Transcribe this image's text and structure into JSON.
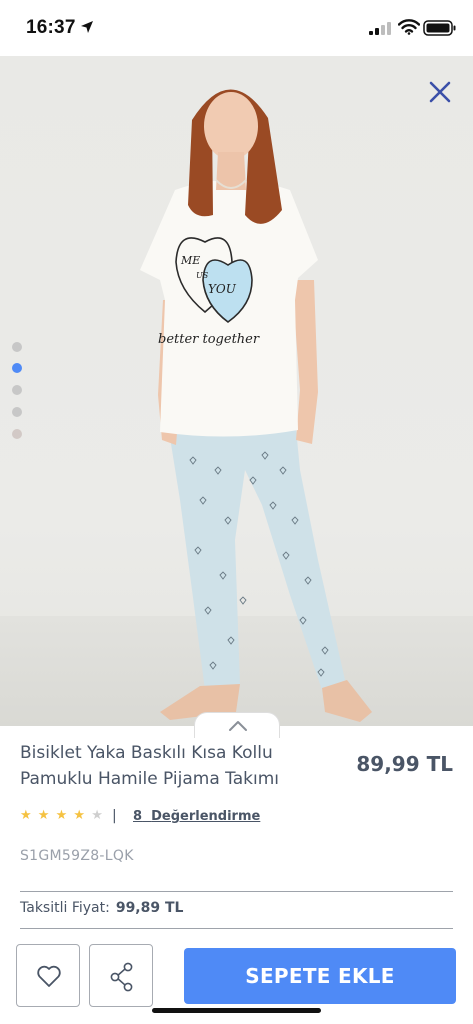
{
  "status_bar": {
    "time": "16:37"
  },
  "hero": {
    "shirt_print": {
      "me": "ME",
      "us": "US",
      "you": "YOU",
      "tagline": "better together"
    },
    "carousel": {
      "count": 5,
      "active_index": 1
    }
  },
  "product": {
    "title_line1": "Bisiklet Yaka Baskılı Kısa Kollu",
    "title_line2": "Pamuklu Hamile Pijama Takımı",
    "price": "89,99 TL",
    "rating": 4,
    "rating_max": 5,
    "rating_separator": "|",
    "review_count": "8",
    "review_label": "Değerlendirme",
    "sku": "S1GM59Z8-LQK",
    "installment_label": "Taksitli Fiyat:",
    "installment_price": "99,89 TL"
  },
  "actions": {
    "add_to_cart": "SEPETE EKLE"
  },
  "colors": {
    "accent": "#4f8af6",
    "text": "#4a5566",
    "star": "#f5c242",
    "close_icon": "#3a4fa8"
  },
  "icons": {
    "close": "close-icon",
    "favorite": "heart-icon",
    "share": "share-icon",
    "expand": "chevron-up-icon"
  }
}
